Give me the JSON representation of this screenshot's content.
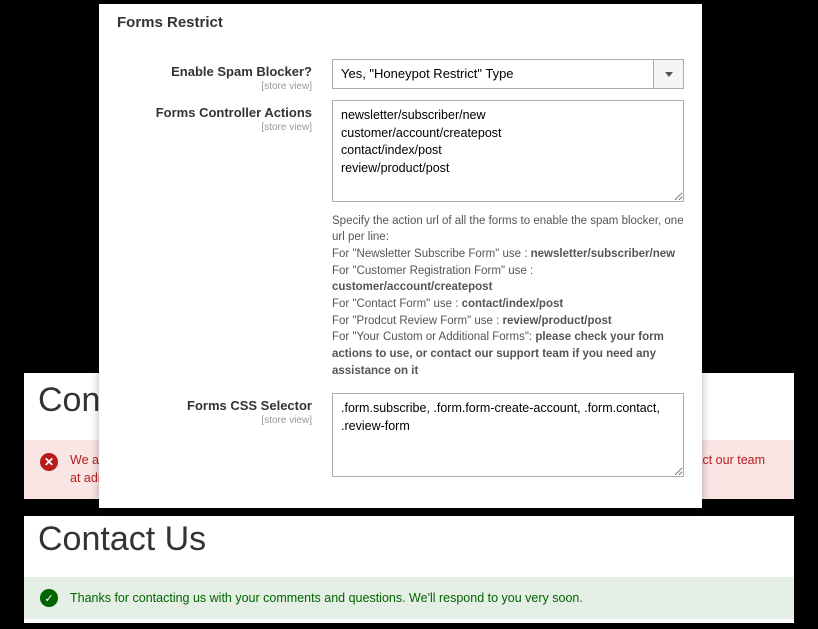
{
  "admin": {
    "sectionTitle": "Forms Restrict",
    "fields": {
      "enable": {
        "label": "Enable Spam Blocker?",
        "scope": "[store view]",
        "value": "Yes, \"Honeypot Restrict\" Type"
      },
      "actions": {
        "label": "Forms Controller Actions",
        "scope": "[store view]",
        "value": "newsletter/subscriber/new\ncustomer/account/createpost\ncontact/index/post\nreview/product/post",
        "help": {
          "line1": "Specify the action url of all the forms to enable the spam blocker, one url per line:",
          "line2a": "For \"Newsletter Subscribe Form\" use : ",
          "line2b": "newsletter/subscriber/new",
          "line3a": "For \"Customer Registration Form\" use : ",
          "line3b": "customer/account/createpost",
          "line4a": "For \"Contact Form\" use : ",
          "line4b": "contact/index/post",
          "line5a": "For \"Prodcut Review Form\" use : ",
          "line5b": "review/product/post",
          "line6a": "For \"Your Custom or Additional Forms\": ",
          "line6b": "please check your form actions to use, or contact our support team if you need any assistance on it"
        }
      },
      "css": {
        "label": "Forms CSS Selector",
        "scope": "[store view]",
        "value": ".form.subscribe, .form.form-create-account, .form.contact, .review-form"
      }
    }
  },
  "page1": {
    "title": "Cont",
    "errorMsg": "We are sorry, you can not submit this form for now. Our spam blocker tool has detected you as a bot. Please contact our team at admin@store.com in case you are not a bot"
  },
  "page2": {
    "title": "Contact Us",
    "successMsg": "Thanks for contacting us with your comments and questions. We'll respond to you very soon."
  }
}
